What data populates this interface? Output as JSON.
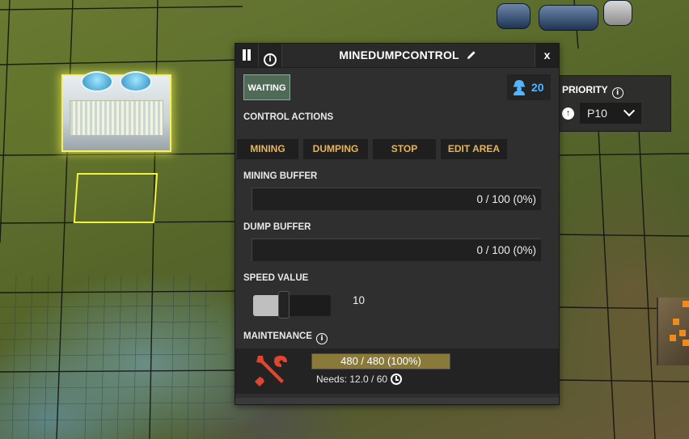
{
  "window": {
    "title": "MINEDUMPCONTROL",
    "close_label": "x",
    "status": "WAITING",
    "workers": "20"
  },
  "control_actions": {
    "label": "CONTROL ACTIONS",
    "buttons": [
      "MINING",
      "DUMPING",
      "STOP",
      "EDIT AREA"
    ]
  },
  "mining_buffer": {
    "label": "MINING BUFFER",
    "value": 0,
    "capacity": 100,
    "text": "0 / 100 (0%)"
  },
  "dump_buffer": {
    "label": "DUMP BUFFER",
    "value": 0,
    "capacity": 100,
    "text": "0 / 100 (0%)"
  },
  "speed": {
    "label": "SPEED VALUE",
    "value": "10",
    "fill_fraction": 0.4
  },
  "maintenance": {
    "label": "MAINTENANCE",
    "value": 480,
    "capacity": 480,
    "text": "480 / 480 (100%)",
    "needs": "Needs: 12.0 / 60"
  },
  "priority": {
    "label": "PRIORITY",
    "selected": "P10"
  },
  "icons": {
    "pause": "pause-icon",
    "info": "info-icon",
    "edit": "pencil-icon",
    "worker": "worker-icon",
    "up": "arrow-up-icon",
    "dropdown": "chevron-down-icon",
    "maintenance": "wrench-screwdriver-icon",
    "clock": "clock-icon"
  },
  "colors": {
    "panel_bg": "#2f2f2f",
    "button_text": "#e7b55a",
    "status_bg": "#4f6a56",
    "worker_blue": "#4fb6ff",
    "maint_fill": "#8a7a3a",
    "tool_red": "#e0452f",
    "selection_yellow": "#f2f23a"
  }
}
